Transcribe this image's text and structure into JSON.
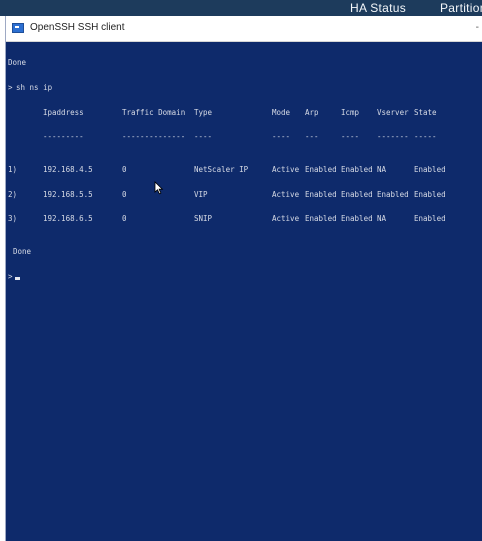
{
  "background": {
    "ha_status": "HA Status",
    "partition": "Partition"
  },
  "window": {
    "title": "OpenSSH SSH client",
    "minimize": "-"
  },
  "terminal": {
    "line_done_1": "Done",
    "prompt": ">",
    "command": "sh ns ip",
    "headers": {
      "ipaddress": "Ipaddress",
      "traffic_domain": "Traffic Domain",
      "type": "Type",
      "mode": "Mode",
      "arp": "Arp",
      "icmp": "Icmp",
      "vserver": "Vserver",
      "state": "State"
    },
    "separators": {
      "ipaddress": "---------",
      "traffic_domain": "--------------",
      "type": "----",
      "mode": "----",
      "arp": "---",
      "icmp": "----",
      "vserver": "-------",
      "state": "-----"
    },
    "rows": [
      {
        "idx": "1)",
        "ip": "192.168.4.5",
        "td": "0",
        "type": "NetScaler IP",
        "mode": "Active",
        "arp": "Enabled",
        "icmp": "Enabled",
        "vserver": "NA",
        "state": "Enabled"
      },
      {
        "idx": "2)",
        "ip": "192.168.5.5",
        "td": "0",
        "type": "VIP",
        "mode": "Active",
        "arp": "Enabled",
        "icmp": "Enabled",
        "vserver": "Enabled",
        "state": "Enabled"
      },
      {
        "idx": "3)",
        "ip": "192.168.6.5",
        "td": "0",
        "type": "SNIP",
        "mode": "Active",
        "arp": "Enabled",
        "icmp": "Enabled",
        "vserver": "NA",
        "state": "Enabled"
      }
    ],
    "line_done_2": "Done",
    "final_prompt": ">"
  },
  "colors": {
    "terminal_bg": "#0e2a6b",
    "terminal_text": "#d7dbe6"
  }
}
